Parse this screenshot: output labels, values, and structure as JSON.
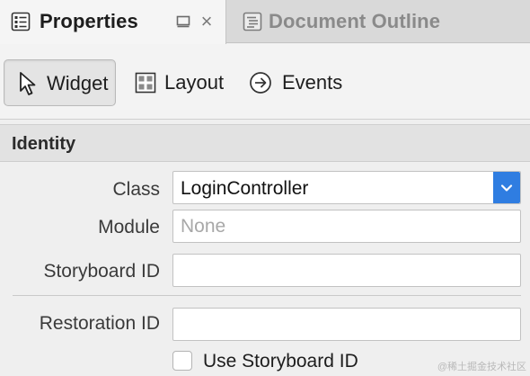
{
  "tabs": {
    "properties": {
      "label": "Properties",
      "icon": "properties-list-icon"
    },
    "document_outline": {
      "label": "Document Outline",
      "icon": "document-outline-icon"
    },
    "controls": {
      "maximize_icon": "maximize-icon",
      "close_glyph": "×"
    }
  },
  "subtabs": [
    {
      "label": "Widget",
      "icon": "cursor-arrow-icon",
      "selected": true
    },
    {
      "label": "Layout",
      "icon": "layout-grid-icon",
      "selected": false
    },
    {
      "label": "Events",
      "icon": "circle-arrow-icon",
      "selected": false
    }
  ],
  "identity": {
    "title": "Identity",
    "class_label": "Class",
    "class_value": "LoginController",
    "module_label": "Module",
    "module_placeholder": "None",
    "storyboard_id_label": "Storyboard ID",
    "storyboard_id_value": "",
    "restoration_id_label": "Restoration ID",
    "restoration_id_value": "",
    "use_storyboard_id_label": "Use Storyboard ID",
    "use_storyboard_id_checked": false
  },
  "colors": {
    "accent": "#2f7de1",
    "panel_bg": "#efefef",
    "tab_active_bg": "#f5f5f5",
    "tab_inactive_bg": "#d9d9d9"
  },
  "watermark": "@稀土掘金技术社区"
}
